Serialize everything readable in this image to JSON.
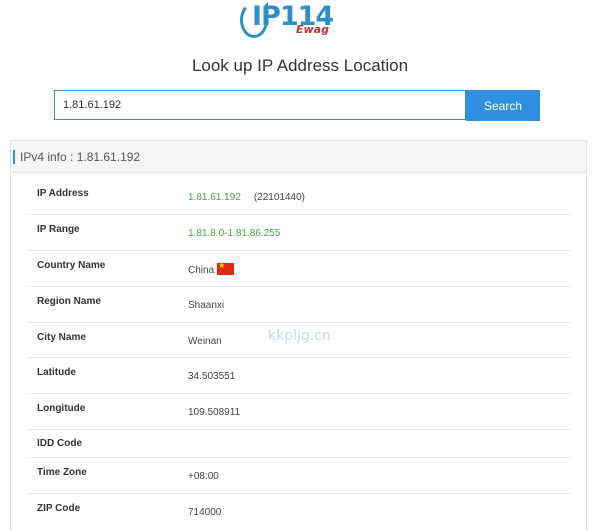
{
  "logo": {
    "text": "IP114",
    "sub": "Ewag"
  },
  "heading": "Look up IP Address Location",
  "search": {
    "value": "1.81.61.192",
    "button_label": "Search"
  },
  "panel": {
    "title": "IPv4 info : 1.81.61.192",
    "rows": [
      {
        "label": "IP Address",
        "value": "1.81.61.192",
        "extra": "(22101440)"
      },
      {
        "label": "IP Range",
        "value": "1.81.8.0-1.81.86.255"
      },
      {
        "label": "Country Name",
        "value": "China",
        "flag": "china-flag-icon"
      },
      {
        "label": "Region Name",
        "value": "Shaanxi"
      },
      {
        "label": "City Name",
        "value": "Weinan"
      },
      {
        "label": "Latitude",
        "value": "34.503551"
      },
      {
        "label": "Longitude",
        "value": "109.508911"
      },
      {
        "label": "IDD Code",
        "value": ""
      },
      {
        "label": "Time Zone",
        "value": "+08:00"
      },
      {
        "label": "ZIP Code",
        "value": "714000"
      }
    ]
  },
  "watermark": "kkpljg.cn",
  "colors": {
    "accent": "#2f8fe0",
    "value_green": "#4aa04a"
  }
}
